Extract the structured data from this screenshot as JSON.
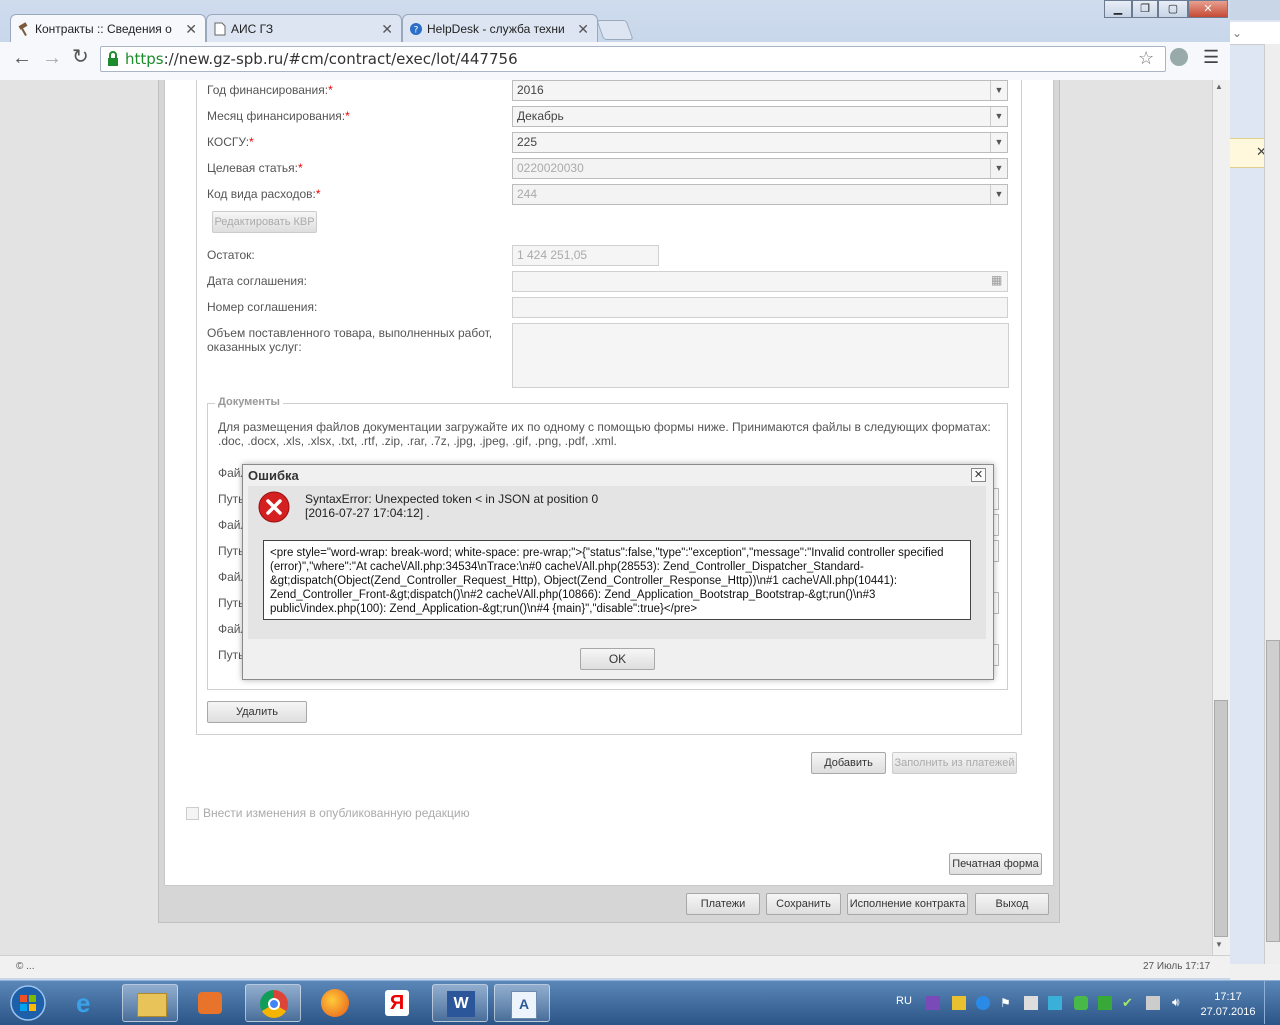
{
  "browser": {
    "tabs": [
      {
        "title": "Контракты :: Сведения о"
      },
      {
        "title": "АИС ГЗ"
      },
      {
        "title": "HelpDesk - служба техни"
      }
    ],
    "url_scheme": "https",
    "url_rest": "://new.gz-spb.ru/#cm/contract/exec/lot/447756",
    "status_left": "© ...",
    "status_right": "27 Июль 17:17"
  },
  "form": {
    "fields": [
      {
        "label": "Год финансирования:",
        "required": "*",
        "value": "2016"
      },
      {
        "label": "Месяц финансирования:",
        "required": "*",
        "value": "Декабрь"
      },
      {
        "label": "КОСГУ:",
        "required": "*",
        "value": "225"
      },
      {
        "label": "Целевая статья:",
        "required": "*",
        "value": "0220020030"
      },
      {
        "label": "Код вида расходов:",
        "required": "*",
        "value": "244"
      }
    ],
    "edit_kvr_label": "Редактировать КВР",
    "remainder_label": "Остаток:",
    "remainder_value": "1 424 251,05",
    "agreement_date_label": "Дата соглашения:",
    "agreement_number_label": "Номер соглашения:",
    "volume_label_line1": "Объем поставленного товара, выполненных работ,",
    "volume_label_line2": "оказанных услуг:",
    "docs_title": "Документы",
    "docs_text": "Для размещения файлов документации загружайте их по одному с помощью формы ниже. Принимаются файлы в следующих форматах: .doc, .docx, .xls, .xlsx, .txt, .rtf, .zip, .rar, .7z, .jpg, .jpeg, .gif, .png, .pdf, .xml.",
    "file_label": "Файл",
    "path_label": "Путь",
    "delete_label": "Удалить",
    "add_label": "Добавить",
    "fill_from_payments_label": "Заполнить из платежей",
    "publish_changes_label": "Внести изменения в опубликованную редакцию",
    "print_form_label": "Печатная форма",
    "payments_label": "Платежи",
    "save_label": "Сохранить",
    "execution_label": "Исполнение контракта",
    "exit_label": "Выход"
  },
  "dialog": {
    "title": "Ошибка",
    "message_line1": "SyntaxError: Unexpected token < in JSON at position 0",
    "message_line2": "[2016-07-27 17:04:12] .",
    "details": "<pre style=\"word-wrap: break-word; white-space: pre-wrap;\">{\"status\":false,\"type\":\"exception\",\"message\":\"Invalid controller specified (error)\",\"where\":\"At cache\\/All.php:34534\\nTrace:\\n#0 cache\\/All.php(28553): Zend_Controller_Dispatcher_Standard-&gt;dispatch(Object(Zend_Controller_Request_Http), Object(Zend_Controller_Response_Http))\\n#1 cache\\/All.php(10441): Zend_Controller_Front-&gt;dispatch()\\n#2 cache\\/All.php(10866): Zend_Application_Bootstrap_Bootstrap-&gt;run()\\n#3 public\\/index.php(100): Zend_Application-&gt;run()\\n#4 {main}\",\"disable\":true}</pre>",
    "ok_label": "OK"
  },
  "taskbar": {
    "lang": "RU",
    "time": "17:17",
    "date": "27.07.2016"
  },
  "colors": {
    "https_green": "#1c8c2c",
    "required_red": "#e00000",
    "error_red": "#d42020"
  }
}
